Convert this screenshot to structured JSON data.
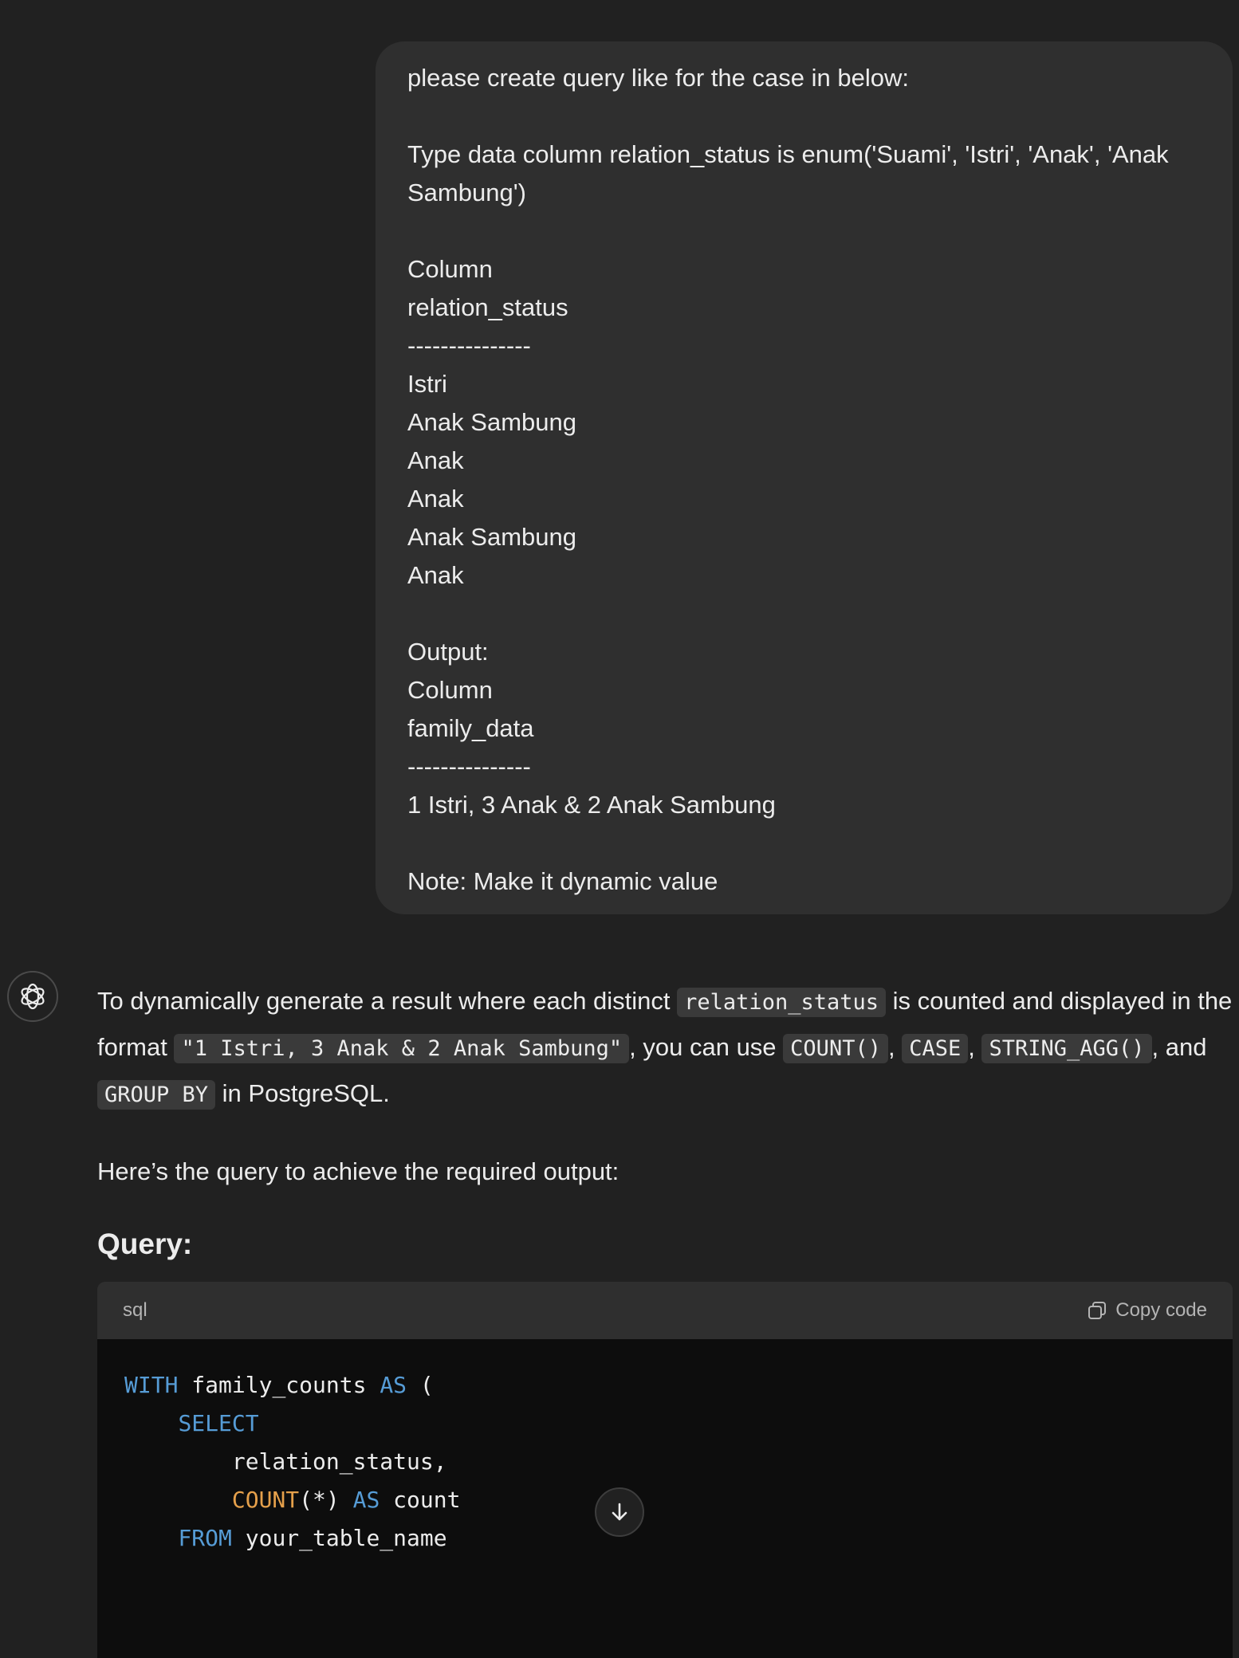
{
  "user_message": {
    "lines": [
      "please create query like for the case in below:",
      "",
      "Type data column relation_status is enum('Suami', 'Istri', 'Anak', 'Anak",
      "Sambung')",
      "",
      "Column",
      "relation_status",
      "---------------",
      "Istri",
      "Anak Sambung",
      "Anak",
      "Anak",
      "Anak Sambung",
      "Anak",
      "",
      "Output:",
      "Column",
      "family_data",
      "---------------",
      "1 Istri, 3 Anak & 2 Anak Sambung",
      "",
      "Note: Make it dynamic value"
    ]
  },
  "assistant": {
    "avatar_icon": "openai-logo-icon",
    "intro": {
      "t1": "To dynamically generate a result where each distinct ",
      "c1": "relation_status",
      "t2": " is counted and displayed in the format ",
      "c2": "\"1 Istri, 3 Anak & 2 Anak Sambung\"",
      "t3": ", you can use ",
      "c3": "COUNT()",
      "t4": ", ",
      "c4": "CASE",
      "t5": ", ",
      "c5": "STRING_AGG()",
      "t6": ", and ",
      "c6": "GROUP BY",
      "t7": " in PostgreSQL."
    },
    "line2": "Here’s the query to achieve the required output:",
    "heading": "Query:",
    "code_block": {
      "language": "sql",
      "copy_label": "Copy code",
      "lines": [
        [
          {
            "t": "WITH",
            "c": "kw"
          },
          {
            "t": " family_counts ",
            "c": ""
          },
          {
            "t": "AS",
            "c": "kw"
          },
          {
            "t": " (",
            "c": ""
          }
        ],
        [
          {
            "t": "    ",
            "c": ""
          },
          {
            "t": "SELECT",
            "c": "kw"
          }
        ],
        [
          {
            "t": "        relation_status,",
            "c": ""
          }
        ],
        [
          {
            "t": "        ",
            "c": ""
          },
          {
            "t": "COUNT",
            "c": "fn"
          },
          {
            "t": "(*) ",
            "c": ""
          },
          {
            "t": "AS",
            "c": "kw"
          },
          {
            "t": " count",
            "c": ""
          }
        ],
        [
          {
            "t": "    ",
            "c": ""
          },
          {
            "t": "FROM",
            "c": "kw"
          },
          {
            "t": " your_table_name",
            "c": ""
          }
        ]
      ]
    }
  },
  "colors": {
    "background": "#212121",
    "user_bubble": "#2f2f2f",
    "keyword": "#569cd6",
    "function": "#e5a04b",
    "code_bg": "#0d0d0d"
  },
  "scroll_button_icon": "arrow-down-icon"
}
